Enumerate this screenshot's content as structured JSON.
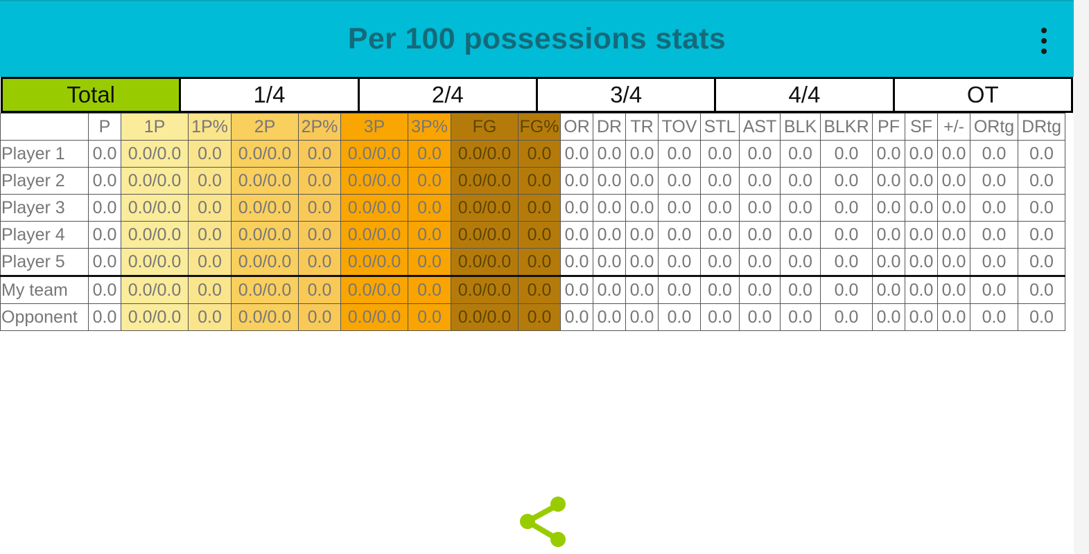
{
  "app": {
    "title": "Per 100 possessions stats"
  },
  "colors": {
    "header_bg": "#01BCD6",
    "title_color": "#146a7a",
    "active_tab": "#99CC00",
    "accent_icon": "#99CC00"
  },
  "icons": {
    "menu": "more-vert-icon",
    "share": "share-icon"
  },
  "tabs": [
    {
      "label": "Total",
      "active": true
    },
    {
      "label": "1/4",
      "active": false
    },
    {
      "label": "2/4",
      "active": false
    },
    {
      "label": "3/4",
      "active": false
    },
    {
      "label": "4/4",
      "active": false
    },
    {
      "label": "OT",
      "active": false
    }
  ],
  "table": {
    "columns": [
      "",
      "P",
      "1P",
      "1P%",
      "2P",
      "2P%",
      "3P",
      "3P%",
      "FG",
      "FG%",
      "OR",
      "DR",
      "TR",
      "TOV",
      "STL",
      "AST",
      "BLK",
      "BLKR",
      "PF",
      "SF",
      "+/-",
      "ORtg",
      "DRtg"
    ],
    "players": [
      {
        "name": "Player 1",
        "values": [
          "0.0",
          "0.0/0.0",
          "0.0",
          "0.0/0.0",
          "0.0",
          "0.0/0.0",
          "0.0",
          "0.0/0.0",
          "0.0",
          "0.0",
          "0.0",
          "0.0",
          "0.0",
          "0.0",
          "0.0",
          "0.0",
          "0.0",
          "0.0",
          "0.0",
          "0.0",
          "0.0",
          "0.0"
        ]
      },
      {
        "name": "Player 2",
        "values": [
          "0.0",
          "0.0/0.0",
          "0.0",
          "0.0/0.0",
          "0.0",
          "0.0/0.0",
          "0.0",
          "0.0/0.0",
          "0.0",
          "0.0",
          "0.0",
          "0.0",
          "0.0",
          "0.0",
          "0.0",
          "0.0",
          "0.0",
          "0.0",
          "0.0",
          "0.0",
          "0.0",
          "0.0"
        ]
      },
      {
        "name": "Player 3",
        "values": [
          "0.0",
          "0.0/0.0",
          "0.0",
          "0.0/0.0",
          "0.0",
          "0.0/0.0",
          "0.0",
          "0.0/0.0",
          "0.0",
          "0.0",
          "0.0",
          "0.0",
          "0.0",
          "0.0",
          "0.0",
          "0.0",
          "0.0",
          "0.0",
          "0.0",
          "0.0",
          "0.0",
          "0.0"
        ]
      },
      {
        "name": "Player 4",
        "values": [
          "0.0",
          "0.0/0.0",
          "0.0",
          "0.0/0.0",
          "0.0",
          "0.0/0.0",
          "0.0",
          "0.0/0.0",
          "0.0",
          "0.0",
          "0.0",
          "0.0",
          "0.0",
          "0.0",
          "0.0",
          "0.0",
          "0.0",
          "0.0",
          "0.0",
          "0.0",
          "0.0",
          "0.0"
        ]
      },
      {
        "name": "Player 5",
        "values": [
          "0.0",
          "0.0/0.0",
          "0.0",
          "0.0/0.0",
          "0.0",
          "0.0/0.0",
          "0.0",
          "0.0/0.0",
          "0.0",
          "0.0",
          "0.0",
          "0.0",
          "0.0",
          "0.0",
          "0.0",
          "0.0",
          "0.0",
          "0.0",
          "0.0",
          "0.0",
          "0.0",
          "0.0"
        ]
      }
    ],
    "teams": [
      {
        "name": "My team",
        "values": [
          "0.0",
          "0.0/0.0",
          "0.0",
          "0.0/0.0",
          "0.0",
          "0.0/0.0",
          "0.0",
          "0.0/0.0",
          "0.0",
          "0.0",
          "0.0",
          "0.0",
          "0.0",
          "0.0",
          "0.0",
          "0.0",
          "0.0",
          "0.0",
          "0.0",
          "0.0",
          "0.0",
          "0.0"
        ]
      },
      {
        "name": "Opponent",
        "values": [
          "0.0",
          "0.0/0.0",
          "0.0",
          "0.0/0.0",
          "0.0",
          "0.0/0.0",
          "0.0",
          "0.0/0.0",
          "0.0",
          "0.0",
          "0.0",
          "0.0",
          "0.0",
          "0.0",
          "0.0",
          "0.0",
          "0.0",
          "0.0",
          "0.0",
          "0.0",
          "0.0",
          "0.0"
        ]
      }
    ]
  }
}
